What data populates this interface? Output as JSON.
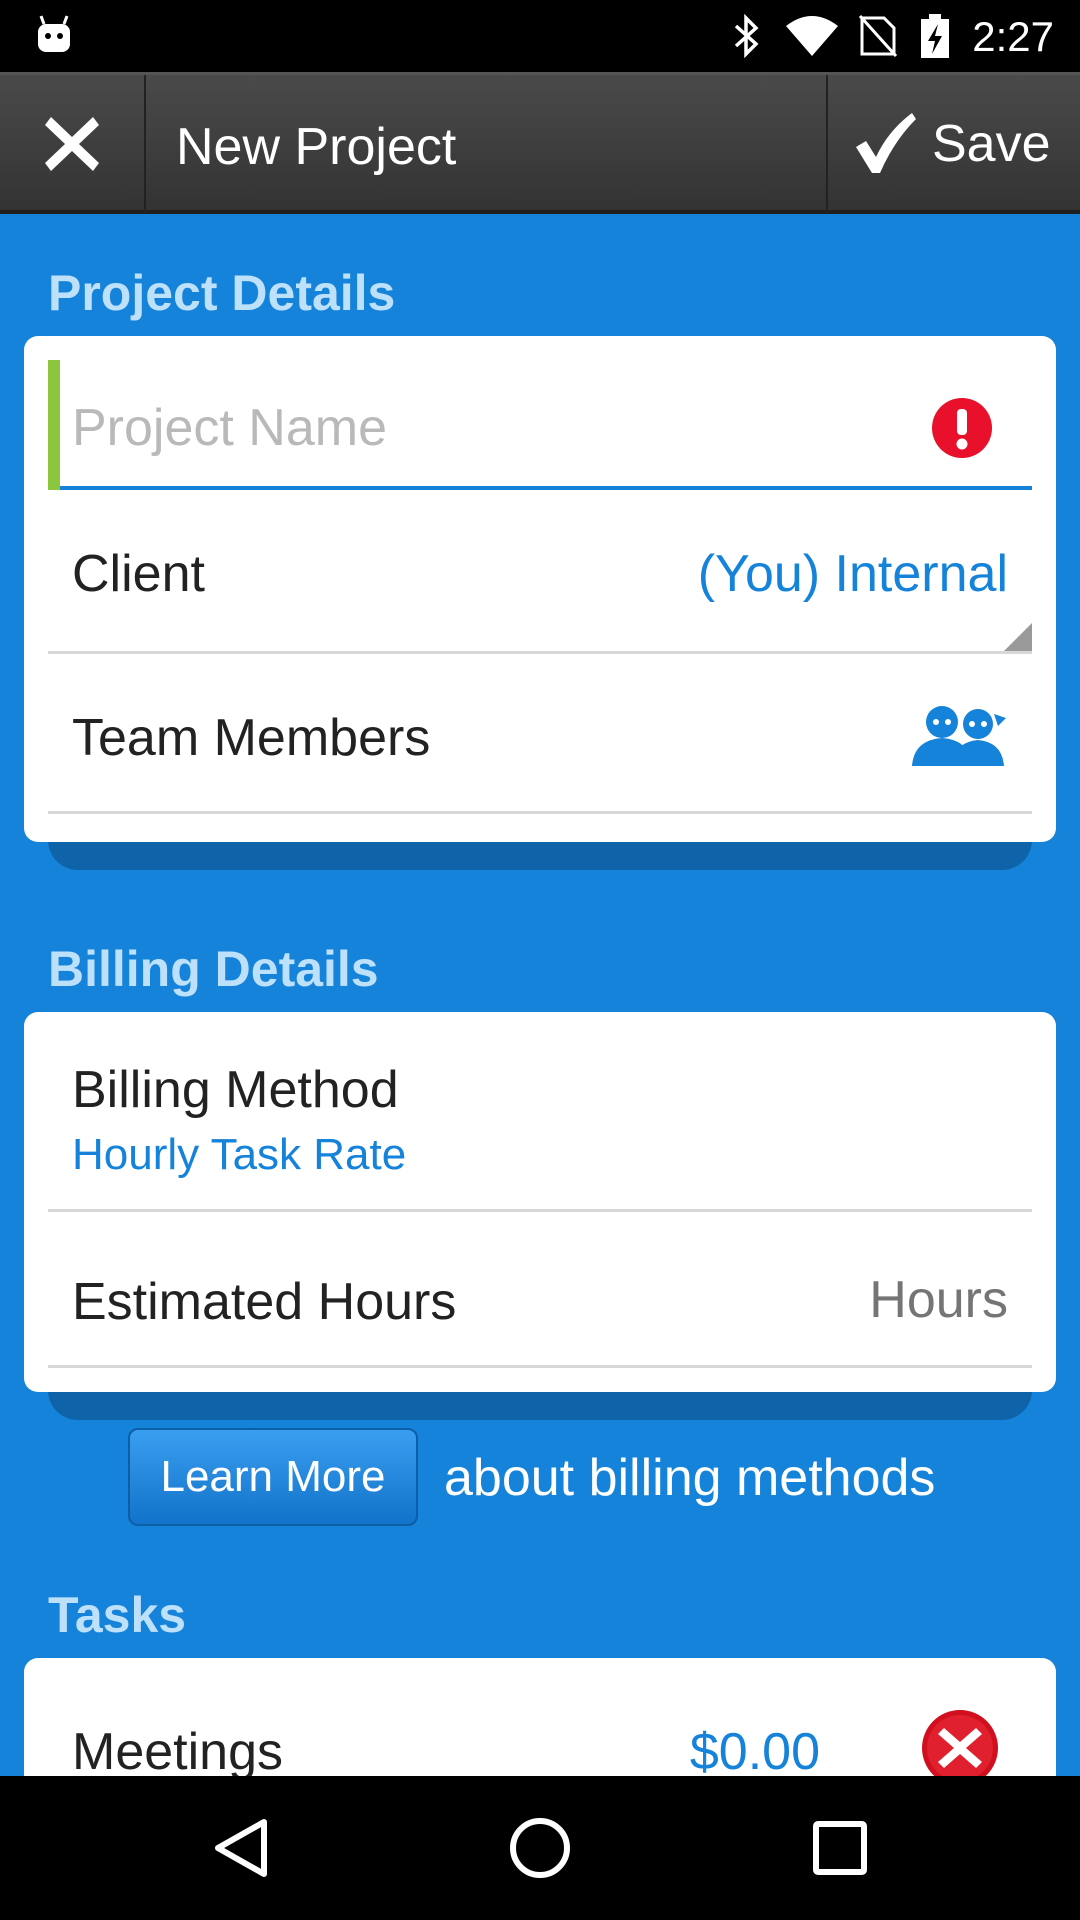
{
  "status_bar": {
    "time": "2:27",
    "icons": [
      "android-icon",
      "bluetooth-icon",
      "wifi-icon",
      "no-sim-icon",
      "battery-charging-icon"
    ]
  },
  "action_bar": {
    "title": "New Project",
    "save_label": "Save",
    "close_icon": "close-icon",
    "save_icon": "checkmark-icon"
  },
  "project_details": {
    "section_title": "Project Details",
    "project_name": {
      "value": "",
      "placeholder": "Project Name",
      "error_icon": "error-icon"
    },
    "client": {
      "label": "Client",
      "value": "(You) Internal"
    },
    "team_members": {
      "label": "Team Members",
      "icon": "team-members-icon"
    }
  },
  "billing_details": {
    "section_title": "Billing Details",
    "billing_method": {
      "label": "Billing Method",
      "value": "Hourly Task Rate"
    },
    "estimated_hours": {
      "label": "Estimated Hours",
      "value": "",
      "placeholder": "Hours"
    },
    "learn_more_label": "Learn More",
    "learn_more_text": "about billing methods"
  },
  "tasks": {
    "section_title": "Tasks",
    "items": [
      {
        "name": "Meetings",
        "rate": "$0.00",
        "remove_icon": "remove-icon"
      }
    ]
  },
  "nav_bar": {
    "icons": [
      "back-icon",
      "home-icon",
      "recents-icon"
    ]
  },
  "colors": {
    "background": "#1583d9",
    "section_title": "#bde0fb",
    "accent": "#1583d9",
    "error": "#e8102a",
    "valid_bar": "#8cc63f"
  }
}
